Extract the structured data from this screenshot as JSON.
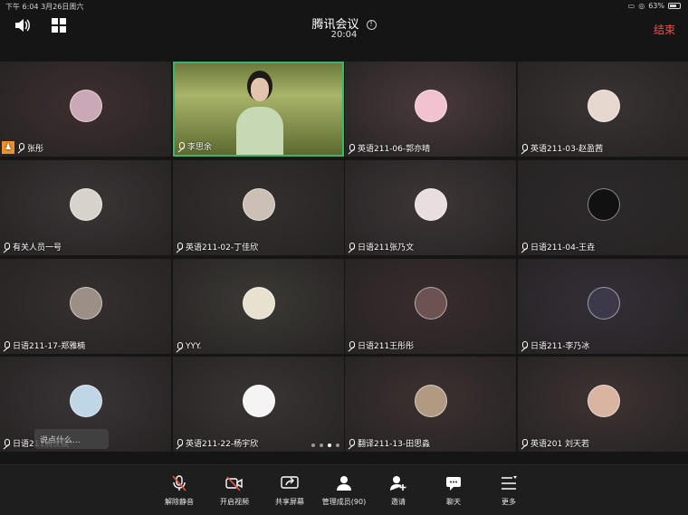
{
  "status_bar": {
    "time": "下午 6:04",
    "date": "3月26日周六",
    "battery": "63%"
  },
  "header": {
    "title": "腾讯会议",
    "timer": "20:04",
    "end_label": "结束",
    "speaker_icon": "speaker-icon",
    "grid_icon": "grid-icon"
  },
  "participants": [
    {
      "name": "张彤",
      "avatar_color": "#caa8b6",
      "bg": "#3e2f30",
      "badge": "host"
    },
    {
      "name": "李思余",
      "video": true
    },
    {
      "name": "英语211-06-郭亦晴",
      "avatar_color": "#f1c3cf",
      "bg": "#4a3a3c"
    },
    {
      "name": "英语211-03-赵盈茜",
      "avatar_color": "#e6d8cf",
      "bg": "#3a3433"
    },
    {
      "name": "有关人员一号",
      "avatar_color": "#d8d2cc",
      "bg": "#3b3536"
    },
    {
      "name": "英语211-02-丁佳欣",
      "avatar_color": "#cbbfb6",
      "bg": "#33302e"
    },
    {
      "name": "日语211张乃文",
      "avatar_color": "#e9dde0",
      "bg": "#3e3638"
    },
    {
      "name": "日语211-04-王垚",
      "avatar_color": "#111111",
      "bg": "#2b2a2a"
    },
    {
      "name": "日语211-17-郑雅楠",
      "avatar_color": "#9b8f86",
      "bg": "#36302f"
    },
    {
      "name": "YYY.",
      "avatar_color": "#e8e1cf",
      "bg": "#3c3a35"
    },
    {
      "name": "日语211王彤彤",
      "avatar_color": "#6d5252",
      "bg": "#3a2c2e"
    },
    {
      "name": "日语211-李乃冰",
      "avatar_color": "#3c3a4a",
      "bg": "#342f38"
    },
    {
      "name": "日语211周汶晨",
      "avatar_color": "#bfd6e6",
      "bg": "#3a3436"
    },
    {
      "name": "英语211-22-杨宇欣",
      "avatar_color": "#f4f4f4",
      "bg": "#3a3535"
    },
    {
      "name": "翻译211-13-田思淼",
      "avatar_color": "#b09a82",
      "bg": "#3d3131"
    },
    {
      "name": "英语201 刘天若",
      "avatar_color": "#d9b4a1",
      "bg": "#3e3332"
    }
  ],
  "chat_float": "说点什么...",
  "toolbar": [
    {
      "label": "解除静音",
      "icon": "mic-off-icon"
    },
    {
      "label": "开启视频",
      "icon": "video-off-icon"
    },
    {
      "label": "共享屏幕",
      "icon": "share-screen-icon"
    },
    {
      "label": "管理成员(90)",
      "icon": "members-icon"
    },
    {
      "label": "邀请",
      "icon": "invite-icon"
    },
    {
      "label": "聊天",
      "icon": "chat-icon"
    },
    {
      "label": "更多",
      "icon": "more-icon"
    }
  ]
}
